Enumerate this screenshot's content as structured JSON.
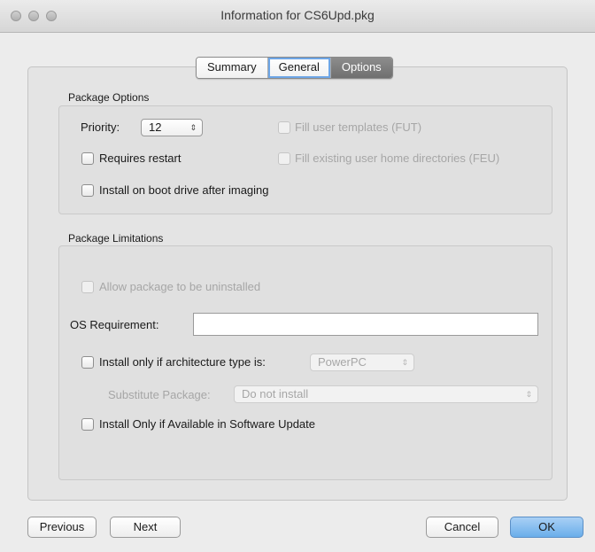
{
  "window": {
    "title": "Information for CS6Upd.pkg"
  },
  "tabs": [
    {
      "label": "Summary"
    },
    {
      "label": "General"
    },
    {
      "label": "Options"
    }
  ],
  "package_options": {
    "title": "Package Options",
    "priority_label": "Priority:",
    "priority_value": "12",
    "requires_restart": "Requires restart",
    "install_on_boot": "Install on boot drive after imaging",
    "fill_user_templates": "Fill user templates (FUT)",
    "fill_existing_homes": "Fill existing user home directories (FEU)"
  },
  "package_limitations": {
    "title": "Package Limitations",
    "allow_uninstall": "Allow package to be uninstalled",
    "os_requirement_label": "OS Requirement:",
    "os_requirement_value": "",
    "arch_label": "Install only if architecture type is:",
    "arch_value": "PowerPC",
    "substitute_label": "Substitute Package:",
    "substitute_value": "Do not install",
    "software_update": "Install Only if Available in Software Update"
  },
  "buttons": {
    "previous": "Previous",
    "next": "Next",
    "cancel": "Cancel",
    "ok": "OK"
  }
}
